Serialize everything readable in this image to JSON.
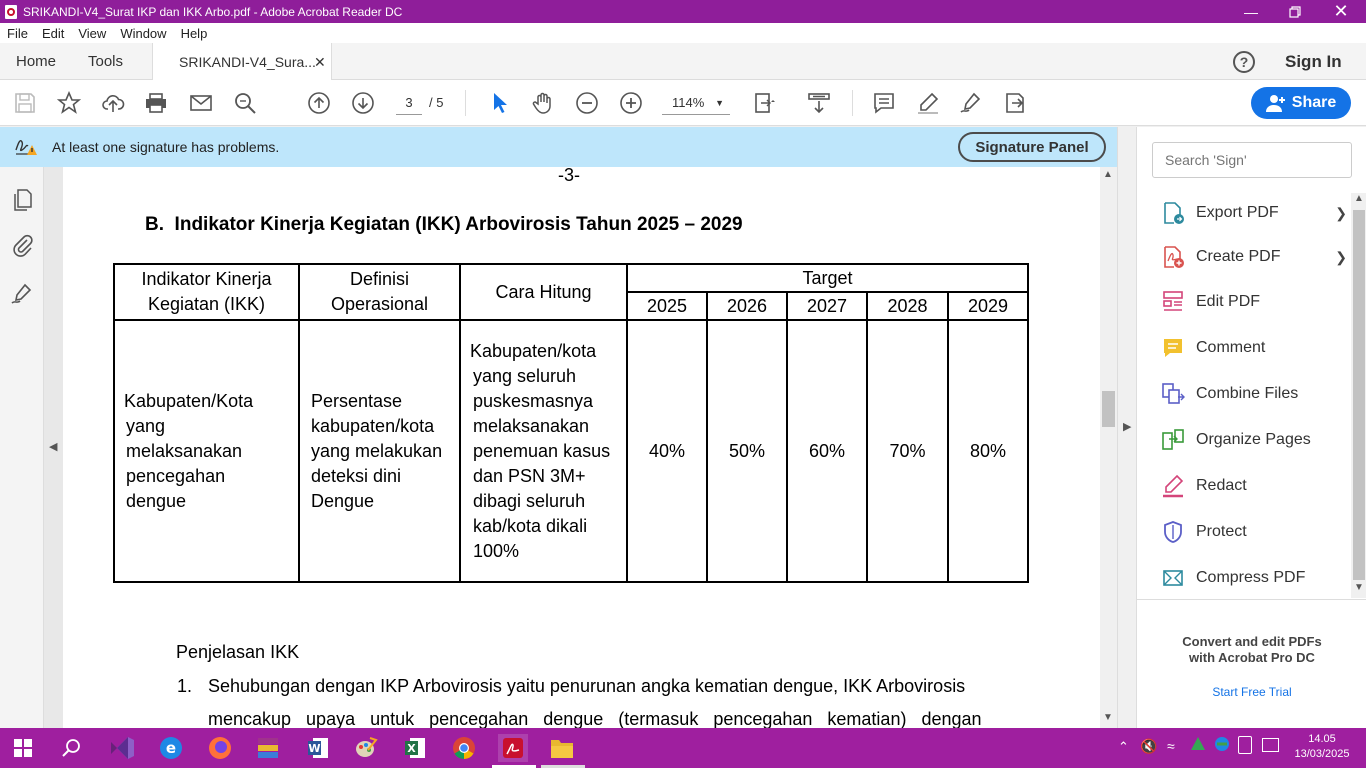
{
  "window": {
    "title": "SRIKANDI-V4_Surat IKP dan IKK Arbo.pdf - Adobe Acrobat Reader DC"
  },
  "menu": [
    "File",
    "Edit",
    "View",
    "Window",
    "Help"
  ],
  "tabs": {
    "home": "Home",
    "tools": "Tools",
    "document": "SRIKANDI-V4_Sura..."
  },
  "header": {
    "sign_in": "Sign In"
  },
  "toolbar": {
    "page_current": "3",
    "page_total": "/ 5",
    "zoom": "114%",
    "share": "Share"
  },
  "signature_bar": {
    "message": "At least one signature has problems.",
    "button": "Signature Panel"
  },
  "document": {
    "page_marker": "-3-",
    "heading": "B.  Indikator Kinerja Kegiatan (IKK) Arbovirosis Tahun 2025 – 2029",
    "table": {
      "headers": {
        "ikk": [
          "Indikator Kinerja",
          "Kegiatan (IKK)"
        ],
        "definisi": [
          "Definisi",
          "Operasional"
        ],
        "cara": "Cara Hitung",
        "target": "Target",
        "years": [
          "2025",
          "2026",
          "2027",
          "2028",
          "2029"
        ]
      },
      "row": {
        "ikk": [
          "Kabupaten/Kota",
          "yang",
          "melaksanakan",
          "pencegahan",
          "dengue"
        ],
        "definisi": [
          "Persentase",
          "kabupaten/kota",
          "yang melakukan",
          "deteksi dini",
          "Dengue"
        ],
        "cara": [
          "Kabupaten/kota",
          "yang seluruh",
          "puskesmasnya",
          "melaksanakan",
          "penemuan kasus",
          "dan PSN 3M+",
          "dibagi seluruh",
          "kab/kota dikali",
          "100%"
        ],
        "targets": [
          "40%",
          "50%",
          "60%",
          "70%",
          "80%"
        ]
      }
    },
    "explanation_title": "Penjelasan IKK",
    "item1_number": "1.",
    "item1_line1": "Sehubungan dengan IKP Arbovirosis yaitu penurunan angka kematian dengue, IKK Arbovirosis",
    "item1_line2": "mencakup   upaya   untuk   pencegahan   dengue   (termasuk   pencegahan   kematian)   dengan"
  },
  "right_panel": {
    "search_placeholder": "Search 'Sign'",
    "tools": [
      "Export PDF",
      "Create PDF",
      "Edit PDF",
      "Comment",
      "Combine Files",
      "Organize Pages",
      "Redact",
      "Protect",
      "Compress PDF"
    ],
    "promo_line1": "Convert and edit PDFs",
    "promo_line2": "with Acrobat Pro DC",
    "promo_link": "Start Free Trial"
  },
  "taskbar": {
    "time": "14.05",
    "date": "13/03/2025"
  },
  "colors": {
    "title_bar": "#8f1e9a",
    "taskbar": "#9f1f9f",
    "accent": "#1473e6",
    "sig_bar": "#bee6fb"
  }
}
